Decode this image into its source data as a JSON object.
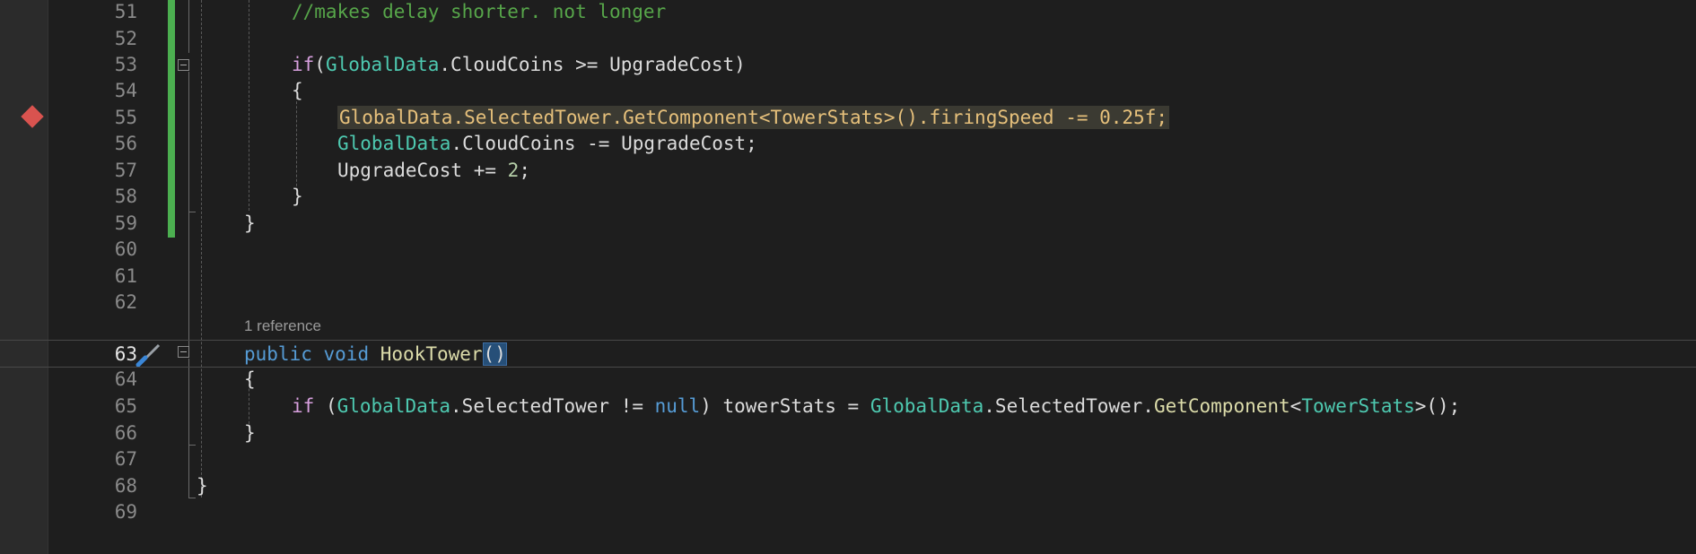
{
  "editor": {
    "lines": [
      {
        "number": "51"
      },
      {
        "number": "52"
      },
      {
        "number": "53"
      },
      {
        "number": "54"
      },
      {
        "number": "55"
      },
      {
        "number": "56"
      },
      {
        "number": "57"
      },
      {
        "number": "58"
      },
      {
        "number": "59"
      },
      {
        "number": "60"
      },
      {
        "number": "61"
      },
      {
        "number": "62"
      },
      {
        "number": "63"
      },
      {
        "number": "64"
      },
      {
        "number": "65"
      },
      {
        "number": "66"
      },
      {
        "number": "67"
      },
      {
        "number": "68"
      },
      {
        "number": "69"
      }
    ],
    "code": {
      "l51_comment": "//makes delay shorter. not longer",
      "l53_if": "if",
      "l53_open": "(",
      "l53_type": "GlobalData",
      "l53_dot": ".",
      "l53_member": "CloudCoins",
      "l53_op": " >= ",
      "l53_var": "UpgradeCost",
      "l53_close": ")",
      "l54_brace": "{",
      "l55_type": "GlobalData",
      "l55_a": ".SelectedTower.",
      "l55_method": "GetComponent",
      "l55_lt": "<",
      "l55_type2": "TowerStats",
      "l55_b": ">().firingSpeed -= ",
      "l55_num": "0.25f",
      "l55_semi": ";",
      "l56_type": "GlobalData",
      "l56_rest": ".CloudCoins -= UpgradeCost;",
      "l57_var": "UpgradeCost += ",
      "l57_num": "2",
      "l57_semi": ";",
      "l58_brace": "}",
      "l59_brace": "}",
      "l63_public": "public",
      "l63_void": "void",
      "l63_method": "HookTower",
      "l63_parens": "()",
      "l64_brace": "{",
      "l65_if": "if",
      "l65_open": " (",
      "l65_type": "GlobalData",
      "l65_a": ".SelectedTower != ",
      "l65_null": "null",
      "l65_b": ") towerStats = ",
      "l65_type2": "GlobalData",
      "l65_c": ".SelectedTower.",
      "l65_method": "GetComponent",
      "l65_lt": "<",
      "l65_type3": "TowerStats",
      "l65_end": ">();",
      "l66_brace": "}",
      "l68_brace": "}"
    },
    "codelens": "1 reference",
    "current_line": "63",
    "breakpoint_line": "55"
  },
  "icons": {
    "breakpoint": "breakpoint-icon",
    "quick_actions": "screwdriver-icon",
    "fold": "collapse-icon"
  },
  "colors": {
    "background": "#1e1e1e",
    "keyword": "#569cd6",
    "control": "#d8a0df",
    "type": "#4ec9b0",
    "method": "#dcdcaa",
    "comment": "#57a64a",
    "number": "#b5cea8",
    "change_bar": "#4caf50",
    "breakpoint": "#d9534f"
  }
}
